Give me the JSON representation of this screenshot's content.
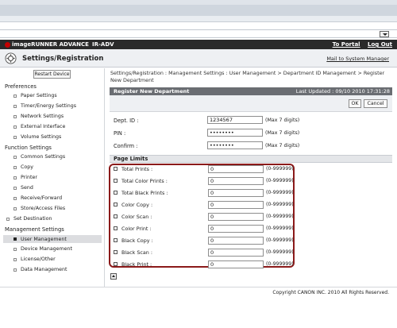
{
  "header": {
    "brand": "imageRUNNER ADVANCE",
    "model": "IR-ADV",
    "to_portal": "To Portal",
    "log_out": "Log Out"
  },
  "titlebar": {
    "title": "Settings/Registration",
    "mail_link": "Mail to System Manager",
    "icon": "settings-gear-icon"
  },
  "sidebar": {
    "restart_label": "Restart Device",
    "sections": [
      {
        "label": "Preferences"
      },
      {
        "label": "Function Settings"
      },
      {
        "label": "Set Destination"
      },
      {
        "label": "Management Settings"
      }
    ],
    "items": {
      "preferences": [
        "Paper Settings",
        "Timer/Energy Settings",
        "Network Settings",
        "External Interface",
        "Volume Settings"
      ],
      "function_settings": [
        "Common Settings",
        "Copy",
        "Printer",
        "Send",
        "Receive/Forward",
        "Store/Access Files"
      ],
      "management_settings": [
        "User Management",
        "Device Management",
        "License/Other",
        "Data Management"
      ]
    }
  },
  "main": {
    "breadcrumb": "Settings/Registration : Management Settings : User Management > Department ID Management > Register New Department",
    "panel_title": "Register New Department",
    "last_updated": "Last Updated : 09/10 2010 17:31:28",
    "ok_label": "OK",
    "cancel_label": "Cancel",
    "fields": {
      "dept_label": "Dept. ID :",
      "dept_value": "1234567",
      "dept_hint": "(Max 7 digits)",
      "pin_label": "PIN :",
      "pin_value": "••••••••",
      "pin_hint": "(Max 7 digits)",
      "confirm_label": "Confirm :",
      "confirm_value": "••••••••",
      "confirm_hint": "(Max 7 digits)"
    },
    "limits_title": "Page Limits",
    "limits": [
      {
        "label": "Total Prints :",
        "value": "0",
        "range": "(0-999999)"
      },
      {
        "label": "Total Color Prints :",
        "value": "0",
        "range": "(0-999999)"
      },
      {
        "label": "Total Black Prints :",
        "value": "0",
        "range": "(0-999999)"
      },
      {
        "label": "Color Copy :",
        "value": "0",
        "range": "(0-999999)"
      },
      {
        "label": "Color Scan :",
        "value": "0",
        "range": "(0-999999)"
      },
      {
        "label": "Color Print :",
        "value": "0",
        "range": "(0-999999)"
      },
      {
        "label": "Black Copy :",
        "value": "0",
        "range": "(0-999999)"
      },
      {
        "label": "Black Scan :",
        "value": "0",
        "range": "(0-999999)"
      },
      {
        "label": "Black Print :",
        "value": "0",
        "range": "(0-999999)"
      }
    ]
  },
  "footer": {
    "copyright": "Copyright CANON INC. 2010 All Rights Reserved."
  },
  "colors": {
    "accent": "#8b1a1a",
    "header_bg": "#2a2a2a",
    "panel_head": "#6a6d72"
  }
}
